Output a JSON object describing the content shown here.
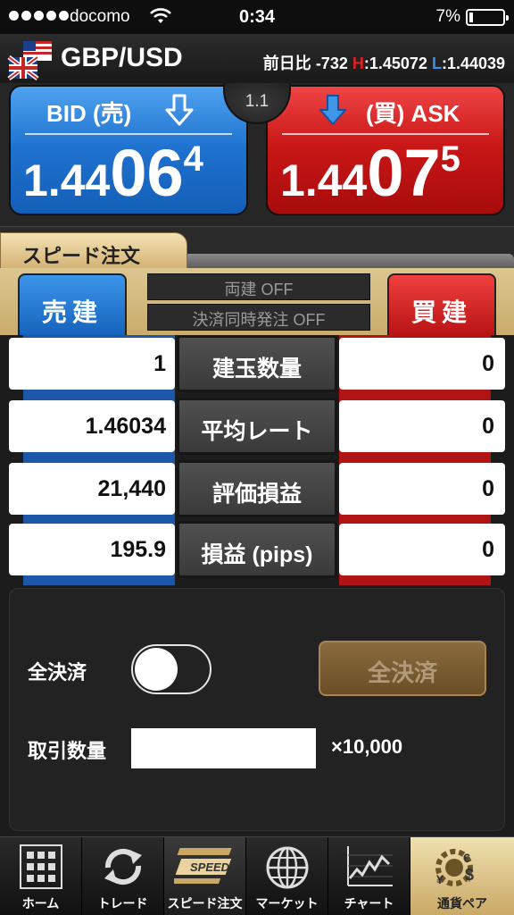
{
  "status_bar": {
    "carrier": "docomo",
    "time": "0:34",
    "battery_percent": "7%",
    "battery_level": 0.07,
    "signal_bars": 5
  },
  "header": {
    "pair": "GBP/USD",
    "change_label": "前日比",
    "change_value": "-732",
    "high_prefix": "H",
    "high_value": ":1.45072",
    "low_prefix": "L",
    "low_value": ":1.44039"
  },
  "quote": {
    "bid": {
      "label": "BID (売)",
      "price_big": "1.44",
      "price_pip": "06",
      "price_frac": "4",
      "arrow": "arrow-down-icon"
    },
    "ask": {
      "label": "(買) ASK",
      "price_big": "1.44",
      "price_pip": "07",
      "price_frac": "5",
      "arrow": "arrow-down-icon"
    },
    "spread": "1.1"
  },
  "tab": {
    "label": "スピード注文"
  },
  "order": {
    "sell_label": "売建",
    "buy_label": "買建",
    "option_hedge": "両建 OFF",
    "option_simultaneous": "決済同時発注 OFF"
  },
  "positions": [
    {
      "label": "建玉数量",
      "sell": "1",
      "buy": "0"
    },
    {
      "label": "平均レート",
      "sell": "1.46034",
      "buy": "0"
    },
    {
      "label": "評価損益",
      "sell": "21,440",
      "buy": "0"
    },
    {
      "label": "損益 (pips)",
      "sell": "195.9",
      "buy": "0"
    }
  ],
  "settlement": {
    "settle_all_label": "全決済",
    "toggle_on": false,
    "settle_all_button": "全決済",
    "quantity_label": "取引数量",
    "quantity_value": "",
    "quantity_unit": "×10,000"
  },
  "nav": [
    {
      "label": "ホーム",
      "icon": "grid-icon"
    },
    {
      "label": "トレード",
      "icon": "refresh-icon"
    },
    {
      "label": "スピード注文",
      "icon": "speed-icon"
    },
    {
      "label": "マーケット",
      "icon": "globe-icon"
    },
    {
      "label": "チャート",
      "icon": "chart-icon"
    },
    {
      "label": "通貨ペア",
      "icon": "currency-icon"
    }
  ],
  "colors": {
    "bid_blue": "#1f72cf",
    "ask_red": "#c81616",
    "gold_panel": "#d4b376",
    "high_red": "#e02020",
    "low_blue": "#3b8ee8"
  }
}
